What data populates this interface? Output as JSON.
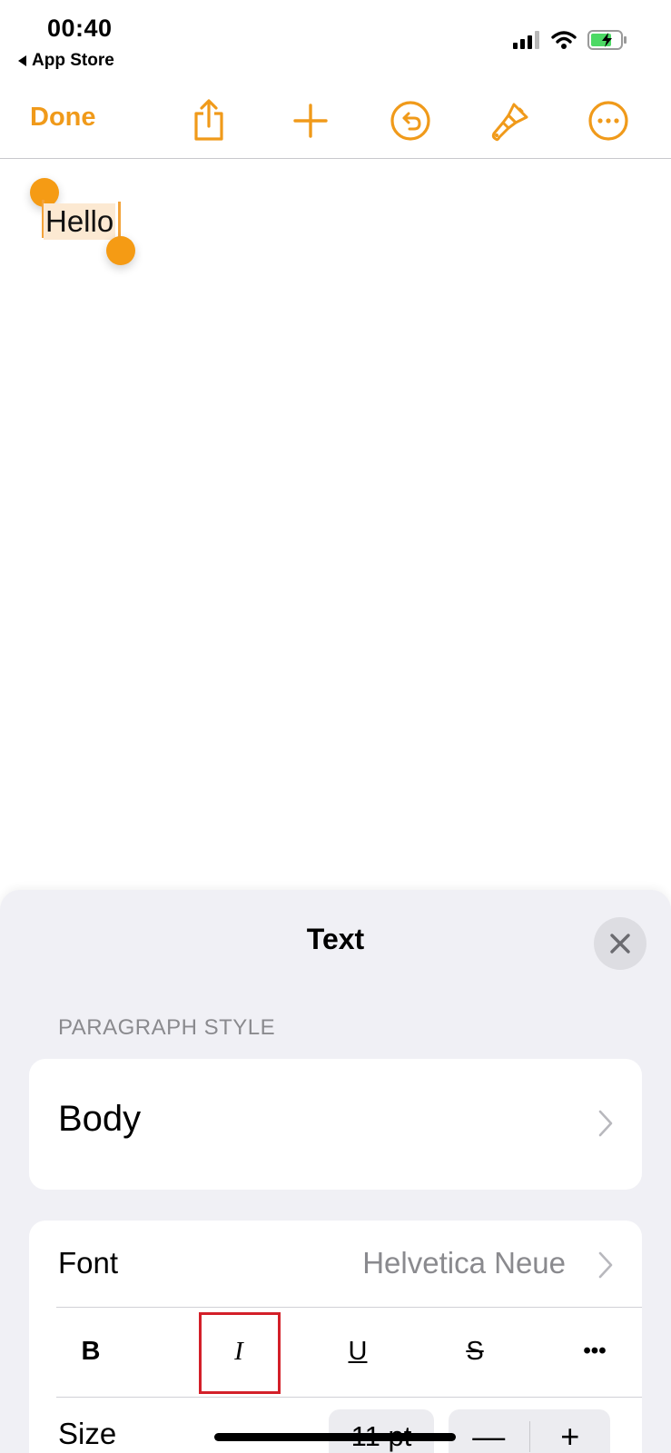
{
  "status_bar": {
    "time": "00:40",
    "back_label": "App Store",
    "icons": [
      "cellular-signal-icon",
      "wifi-icon",
      "battery-charging-icon"
    ],
    "battery_color": "#4cd964"
  },
  "toolbar": {
    "done_label": "Done",
    "icons": [
      "share-icon",
      "add-icon",
      "undo-icon",
      "paintbrush-icon",
      "more-icon"
    ],
    "accent_color": "#f09a1a"
  },
  "document": {
    "selected_text": "Hello",
    "selection_color": "#fce9d2",
    "handle_color": "#f59b14"
  },
  "text_panel": {
    "title": "Text",
    "close_icon": "close-icon",
    "paragraph_style_label": "PARAGRAPH STYLE",
    "paragraph_style_value": "Body",
    "font_label": "Font",
    "font_value": "Helvetica Neue",
    "style_buttons": [
      {
        "label": "B",
        "name": "bold"
      },
      {
        "label": "I",
        "name": "italic"
      },
      {
        "label": "U",
        "name": "underline"
      },
      {
        "label": "S",
        "name": "strikethrough"
      },
      {
        "label": "•••",
        "name": "more-styles"
      }
    ],
    "highlighted_button": "italic",
    "highlight_color": "#d32029",
    "size_label": "Size",
    "size_value": "11 pt",
    "stepper_minus": "—",
    "stepper_plus": "+"
  }
}
